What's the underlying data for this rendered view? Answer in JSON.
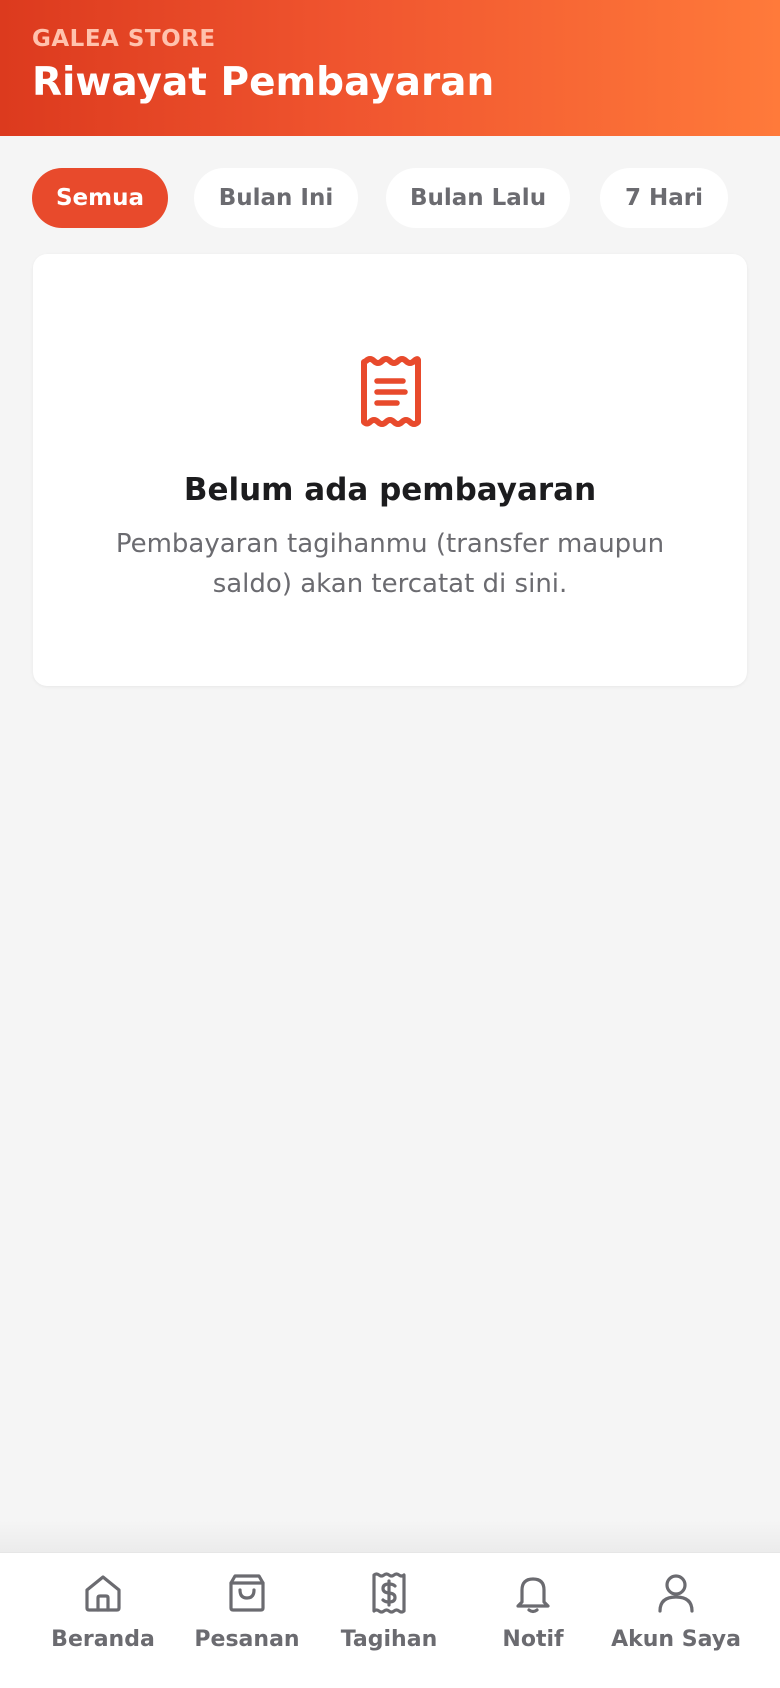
{
  "header": {
    "store_name": "GALEA STORE",
    "title": "Riwayat Pembayaran"
  },
  "filters": [
    {
      "label": "Semua",
      "active": true
    },
    {
      "label": "Bulan Ini",
      "active": false
    },
    {
      "label": "Bulan Lalu",
      "active": false
    },
    {
      "label": "7 Hari",
      "active": false
    }
  ],
  "empty_state": {
    "icon": "receipt-icon",
    "title": "Belum ada pembayaran",
    "description": "Pembayaran tagihanmu (transfer maupun saldo) akan tercatat di sini."
  },
  "bottom_nav": [
    {
      "label": "Beranda",
      "icon": "home-icon"
    },
    {
      "label": "Pesanan",
      "icon": "shopping-bag-icon"
    },
    {
      "label": "Tagihan",
      "icon": "bill-icon"
    },
    {
      "label": "Notif",
      "icon": "bell-icon"
    },
    {
      "label": "Akun Saya",
      "icon": "user-icon"
    }
  ],
  "colors": {
    "accent": "#e84a2c",
    "header_start": "#dc3a1e",
    "header_end": "#ff7a3a",
    "background": "#f5f5f5",
    "muted_text": "#6b6b70"
  }
}
